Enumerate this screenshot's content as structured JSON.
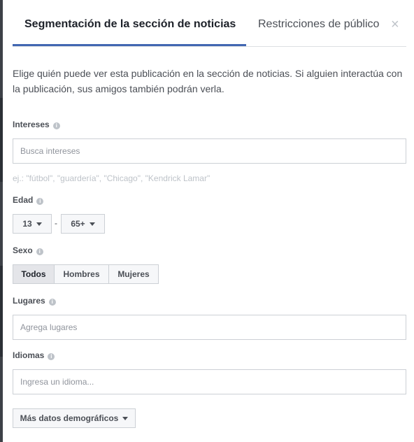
{
  "tabs": [
    {
      "label": "Segmentación de la sección de noticias",
      "active": true
    },
    {
      "label": "Restricciones de público",
      "active": false
    }
  ],
  "close_glyph": "×",
  "description": "Elige quién puede ver esta publicación en la sección de noticias. Si alguien interactúa con la publicación, sus amigos también podrán verla.",
  "interests": {
    "label": "Intereses",
    "placeholder": "Busca intereses",
    "hint": "ej.: \"fútbol\", \"guardería\", \"Chicago\", \"Kendrick Lamar\""
  },
  "age": {
    "label": "Edad",
    "min": "13",
    "separator": "-",
    "max": "65+"
  },
  "gender": {
    "label": "Sexo",
    "options": [
      "Todos",
      "Hombres",
      "Mujeres"
    ],
    "selected": "Todos"
  },
  "locations": {
    "label": "Lugares",
    "placeholder": "Agrega lugares"
  },
  "languages": {
    "label": "Idiomas",
    "placeholder": "Ingresa un idioma..."
  },
  "more_button": {
    "label": "Más datos demográficos"
  },
  "info_glyph": "i",
  "colors": {
    "accent": "#4267b2",
    "text": "#1d2129",
    "secondary_text": "#4b4f56",
    "border": "#ccd0d5"
  },
  "icons": {
    "close": "close-icon",
    "info": "info-icon",
    "dropdown": "caret-down-icon"
  }
}
